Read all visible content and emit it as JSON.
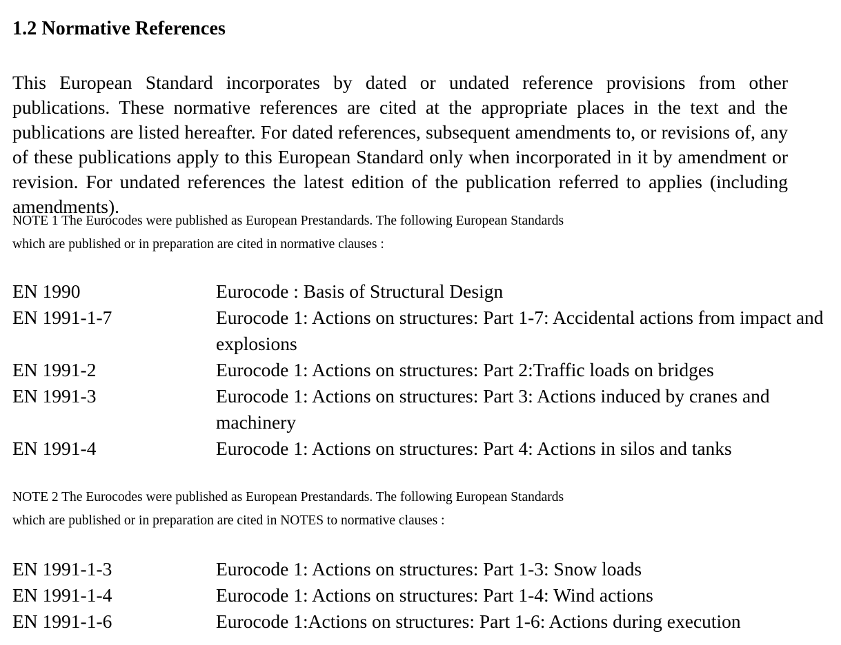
{
  "document": {
    "heading": "1.2 Normative References",
    "intro_paragraph": "This European Standard incorporates by dated or undated reference provisions from other publications. These normative references are cited at the appropriate places in the text and the publications are listed hereafter. For dated references, subsequent amendments to, or revisions of, any of these publications apply to this European Standard only when incorporated in it by amendment or revision. For undated references the latest edition of the publication referred to applies (including amendments).",
    "note_1": {
      "line_1": "NOTE 1 The Eurocodes were published as European Prestandards. The following European Standards",
      "line_2": "which are published or in preparation are cited in normative clauses :"
    },
    "note_2": {
      "line_1": "NOTE 2 The Eurocodes were published as European Prestandards. The following European Standards",
      "line_2": "which are published or in preparation are cited in NOTES to normative clauses :"
    },
    "references_normative": [
      {
        "code": "EN 1990",
        "description": "Eurocode : Basis of Structural Design"
      },
      {
        "code": "EN 1991-1-7",
        "description": "Eurocode 1: Actions on structures: Part 1-7: Accidental actions from impact and explosions"
      },
      {
        "code": "EN 1991-2",
        "description": "Eurocode 1: Actions on structures: Part 2:Traffic loads on bridges"
      },
      {
        "code": "EN 1991-3",
        "description": "Eurocode 1: Actions on structures: Part 3: Actions induced by cranes and machinery"
      },
      {
        "code": "EN 1991-4",
        "description": "Eurocode 1: Actions on structures: Part 4: Actions in silos and tanks"
      }
    ],
    "references_notes": [
      {
        "code": "EN 1991-1-3",
        "description": "Eurocode 1: Actions on structures: Part 1-3: Snow loads"
      },
      {
        "code": "EN 1991-1-4",
        "description": "Eurocode 1: Actions on structures: Part 1-4: Wind actions"
      },
      {
        "code": "EN 1991-1-6",
        "description": "Eurocode 1:Actions on structures: Part 1-6: Actions during execution"
      }
    ]
  }
}
